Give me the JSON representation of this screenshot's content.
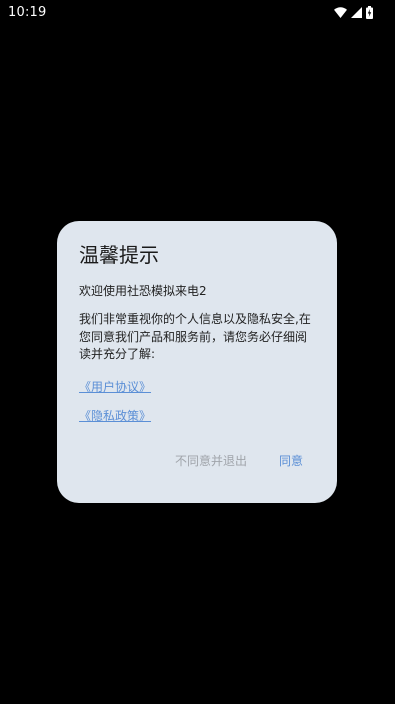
{
  "status_bar": {
    "time": "10:19",
    "icons": [
      "wifi-icon",
      "cellular-signal-icon",
      "battery-charging-icon"
    ]
  },
  "dialog": {
    "title": "温馨提示",
    "welcome": "欢迎使用社恐模拟来电2",
    "body": "我们非常重视你的个人信息以及隐私安全,在您同意我们产品和服务前，请您务必仔细阅读并充分了解:",
    "user_agreement_link": "《用户协议》",
    "privacy_policy_link": "《隐私政策》",
    "disagree_label": "不同意并退出",
    "agree_label": "同意"
  },
  "colors": {
    "background": "#000000",
    "dialog_background": "#dfe6ee",
    "link": "#5b8fd6",
    "disagree_text": "#a0a4aa",
    "body_text": "#222222"
  }
}
